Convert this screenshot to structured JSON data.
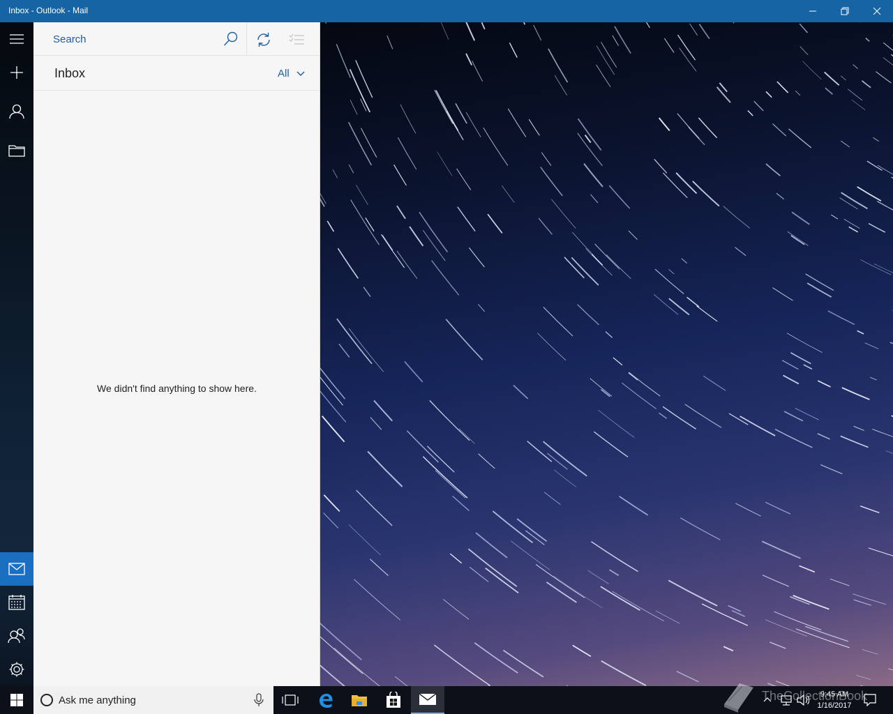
{
  "window": {
    "title": "Inbox - Outlook - Mail",
    "accent": "#1764a5"
  },
  "rail": {
    "items": [
      {
        "name": "hamburger-menu-icon"
      },
      {
        "name": "new-mail-icon"
      },
      {
        "name": "accounts-icon"
      },
      {
        "name": "folders-icon"
      },
      {
        "name": "mail-icon",
        "active": true
      },
      {
        "name": "calendar-icon"
      },
      {
        "name": "people-icon"
      },
      {
        "name": "settings-icon"
      }
    ]
  },
  "list": {
    "search_placeholder": "Search",
    "folder_title": "Inbox",
    "filter_label": "All",
    "empty_message": "We didn't find anything to show here."
  },
  "taskbar": {
    "search_text": "Ask me anything",
    "pinned": [
      "task-view-icon",
      "edge-icon",
      "file-explorer-icon",
      "store-icon",
      "mail-app-icon"
    ],
    "clock_time": "9:45 AM",
    "clock_date": "1/16/2017"
  },
  "watermark": {
    "text": "TheCollectionBook"
  }
}
